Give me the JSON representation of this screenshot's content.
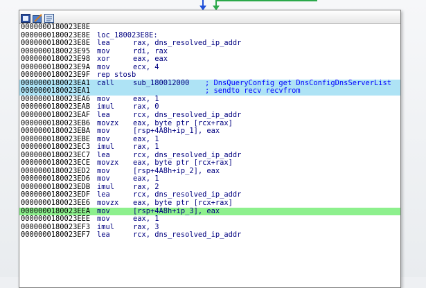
{
  "title_icons": [
    "graph-view-icon",
    "edit-icon",
    "text-view-icon"
  ],
  "colors": {
    "window_bg": "#ffffff",
    "highlight_call": "#aee3f5",
    "highlight_current": "#8df08d",
    "code_text": "#00007f",
    "comment_text": "#0000ff",
    "arrow_blue": "#1f4fd9",
    "arrow_green": "#2aa84a"
  },
  "lines": [
    {
      "addr": "0000000180023E8E",
      "mn": "",
      "ops": "",
      "cmt": "",
      "hl": ""
    },
    {
      "addr": "0000000180023E8E",
      "mn": "loc_180023E8E:",
      "ops": "",
      "cmt": "",
      "hl": ""
    },
    {
      "addr": "0000000180023E8E",
      "mn": "lea",
      "ops": "rax, dns_resolved_ip_addr",
      "cmt": "",
      "hl": ""
    },
    {
      "addr": "0000000180023E95",
      "mn": "mov",
      "ops": "rdi, rax",
      "cmt": "",
      "hl": ""
    },
    {
      "addr": "0000000180023E98",
      "mn": "xor",
      "ops": "eax, eax",
      "cmt": "",
      "hl": ""
    },
    {
      "addr": "0000000180023E9A",
      "mn": "mov",
      "ops": "ecx, 4",
      "cmt": "",
      "hl": ""
    },
    {
      "addr": "0000000180023E9F",
      "mn": "rep stosb",
      "ops": "",
      "cmt": "",
      "hl": ""
    },
    {
      "addr": "0000000180023EA1",
      "mn": "call",
      "ops": "sub_180012000",
      "cmt": "; DnsQueryConfig get DnsConfigDnsServerList",
      "hl": "blue"
    },
    {
      "addr": "0000000180023EA1",
      "mn": "",
      "ops": "",
      "cmt": "; sendto recv recvfrom",
      "hl": "blue"
    },
    {
      "addr": "0000000180023EA6",
      "mn": "mov",
      "ops": "eax, 1",
      "cmt": "",
      "hl": ""
    },
    {
      "addr": "0000000180023EAB",
      "mn": "imul",
      "ops": "rax, 0",
      "cmt": "",
      "hl": ""
    },
    {
      "addr": "0000000180023EAF",
      "mn": "lea",
      "ops": "rcx, dns_resolved_ip_addr",
      "cmt": "",
      "hl": ""
    },
    {
      "addr": "0000000180023EB6",
      "mn": "movzx",
      "ops": "eax, byte ptr [rcx+rax]",
      "cmt": "",
      "hl": ""
    },
    {
      "addr": "0000000180023EBA",
      "mn": "mov",
      "ops": "[rsp+4A8h+ip_1], eax",
      "cmt": "",
      "hl": ""
    },
    {
      "addr": "0000000180023EBE",
      "mn": "mov",
      "ops": "eax, 1",
      "cmt": "",
      "hl": ""
    },
    {
      "addr": "0000000180023EC3",
      "mn": "imul",
      "ops": "rax, 1",
      "cmt": "",
      "hl": ""
    },
    {
      "addr": "0000000180023EC7",
      "mn": "lea",
      "ops": "rcx, dns_resolved_ip_addr",
      "cmt": "",
      "hl": ""
    },
    {
      "addr": "0000000180023ECE",
      "mn": "movzx",
      "ops": "eax, byte ptr [rcx+rax]",
      "cmt": "",
      "hl": ""
    },
    {
      "addr": "0000000180023ED2",
      "mn": "mov",
      "ops": "[rsp+4A8h+ip_2], eax",
      "cmt": "",
      "hl": ""
    },
    {
      "addr": "0000000180023ED6",
      "mn": "mov",
      "ops": "eax, 1",
      "cmt": "",
      "hl": ""
    },
    {
      "addr": "0000000180023EDB",
      "mn": "imul",
      "ops": "rax, 2",
      "cmt": "",
      "hl": ""
    },
    {
      "addr": "0000000180023EDF",
      "mn": "lea",
      "ops": "rcx, dns_resolved_ip_addr",
      "cmt": "",
      "hl": ""
    },
    {
      "addr": "0000000180023EE6",
      "mn": "movzx",
      "ops": "eax, byte ptr [rcx+rax]",
      "cmt": "",
      "hl": ""
    },
    {
      "addr": "0000000180023EEA",
      "mn": "mov",
      "ops": "[rsp+4A8h+ip_3], eax",
      "cmt": "",
      "hl": "green"
    },
    {
      "addr": "0000000180023EEE",
      "mn": "mov",
      "ops": "eax, 1",
      "cmt": "",
      "hl": ""
    },
    {
      "addr": "0000000180023EF3",
      "mn": "imul",
      "ops": "rax, 3",
      "cmt": "",
      "hl": ""
    },
    {
      "addr": "0000000180023EF7",
      "mn": "lea",
      "ops": "rcx, dns_resolved_ip_addr",
      "cmt": "",
      "hl": ""
    }
  ]
}
